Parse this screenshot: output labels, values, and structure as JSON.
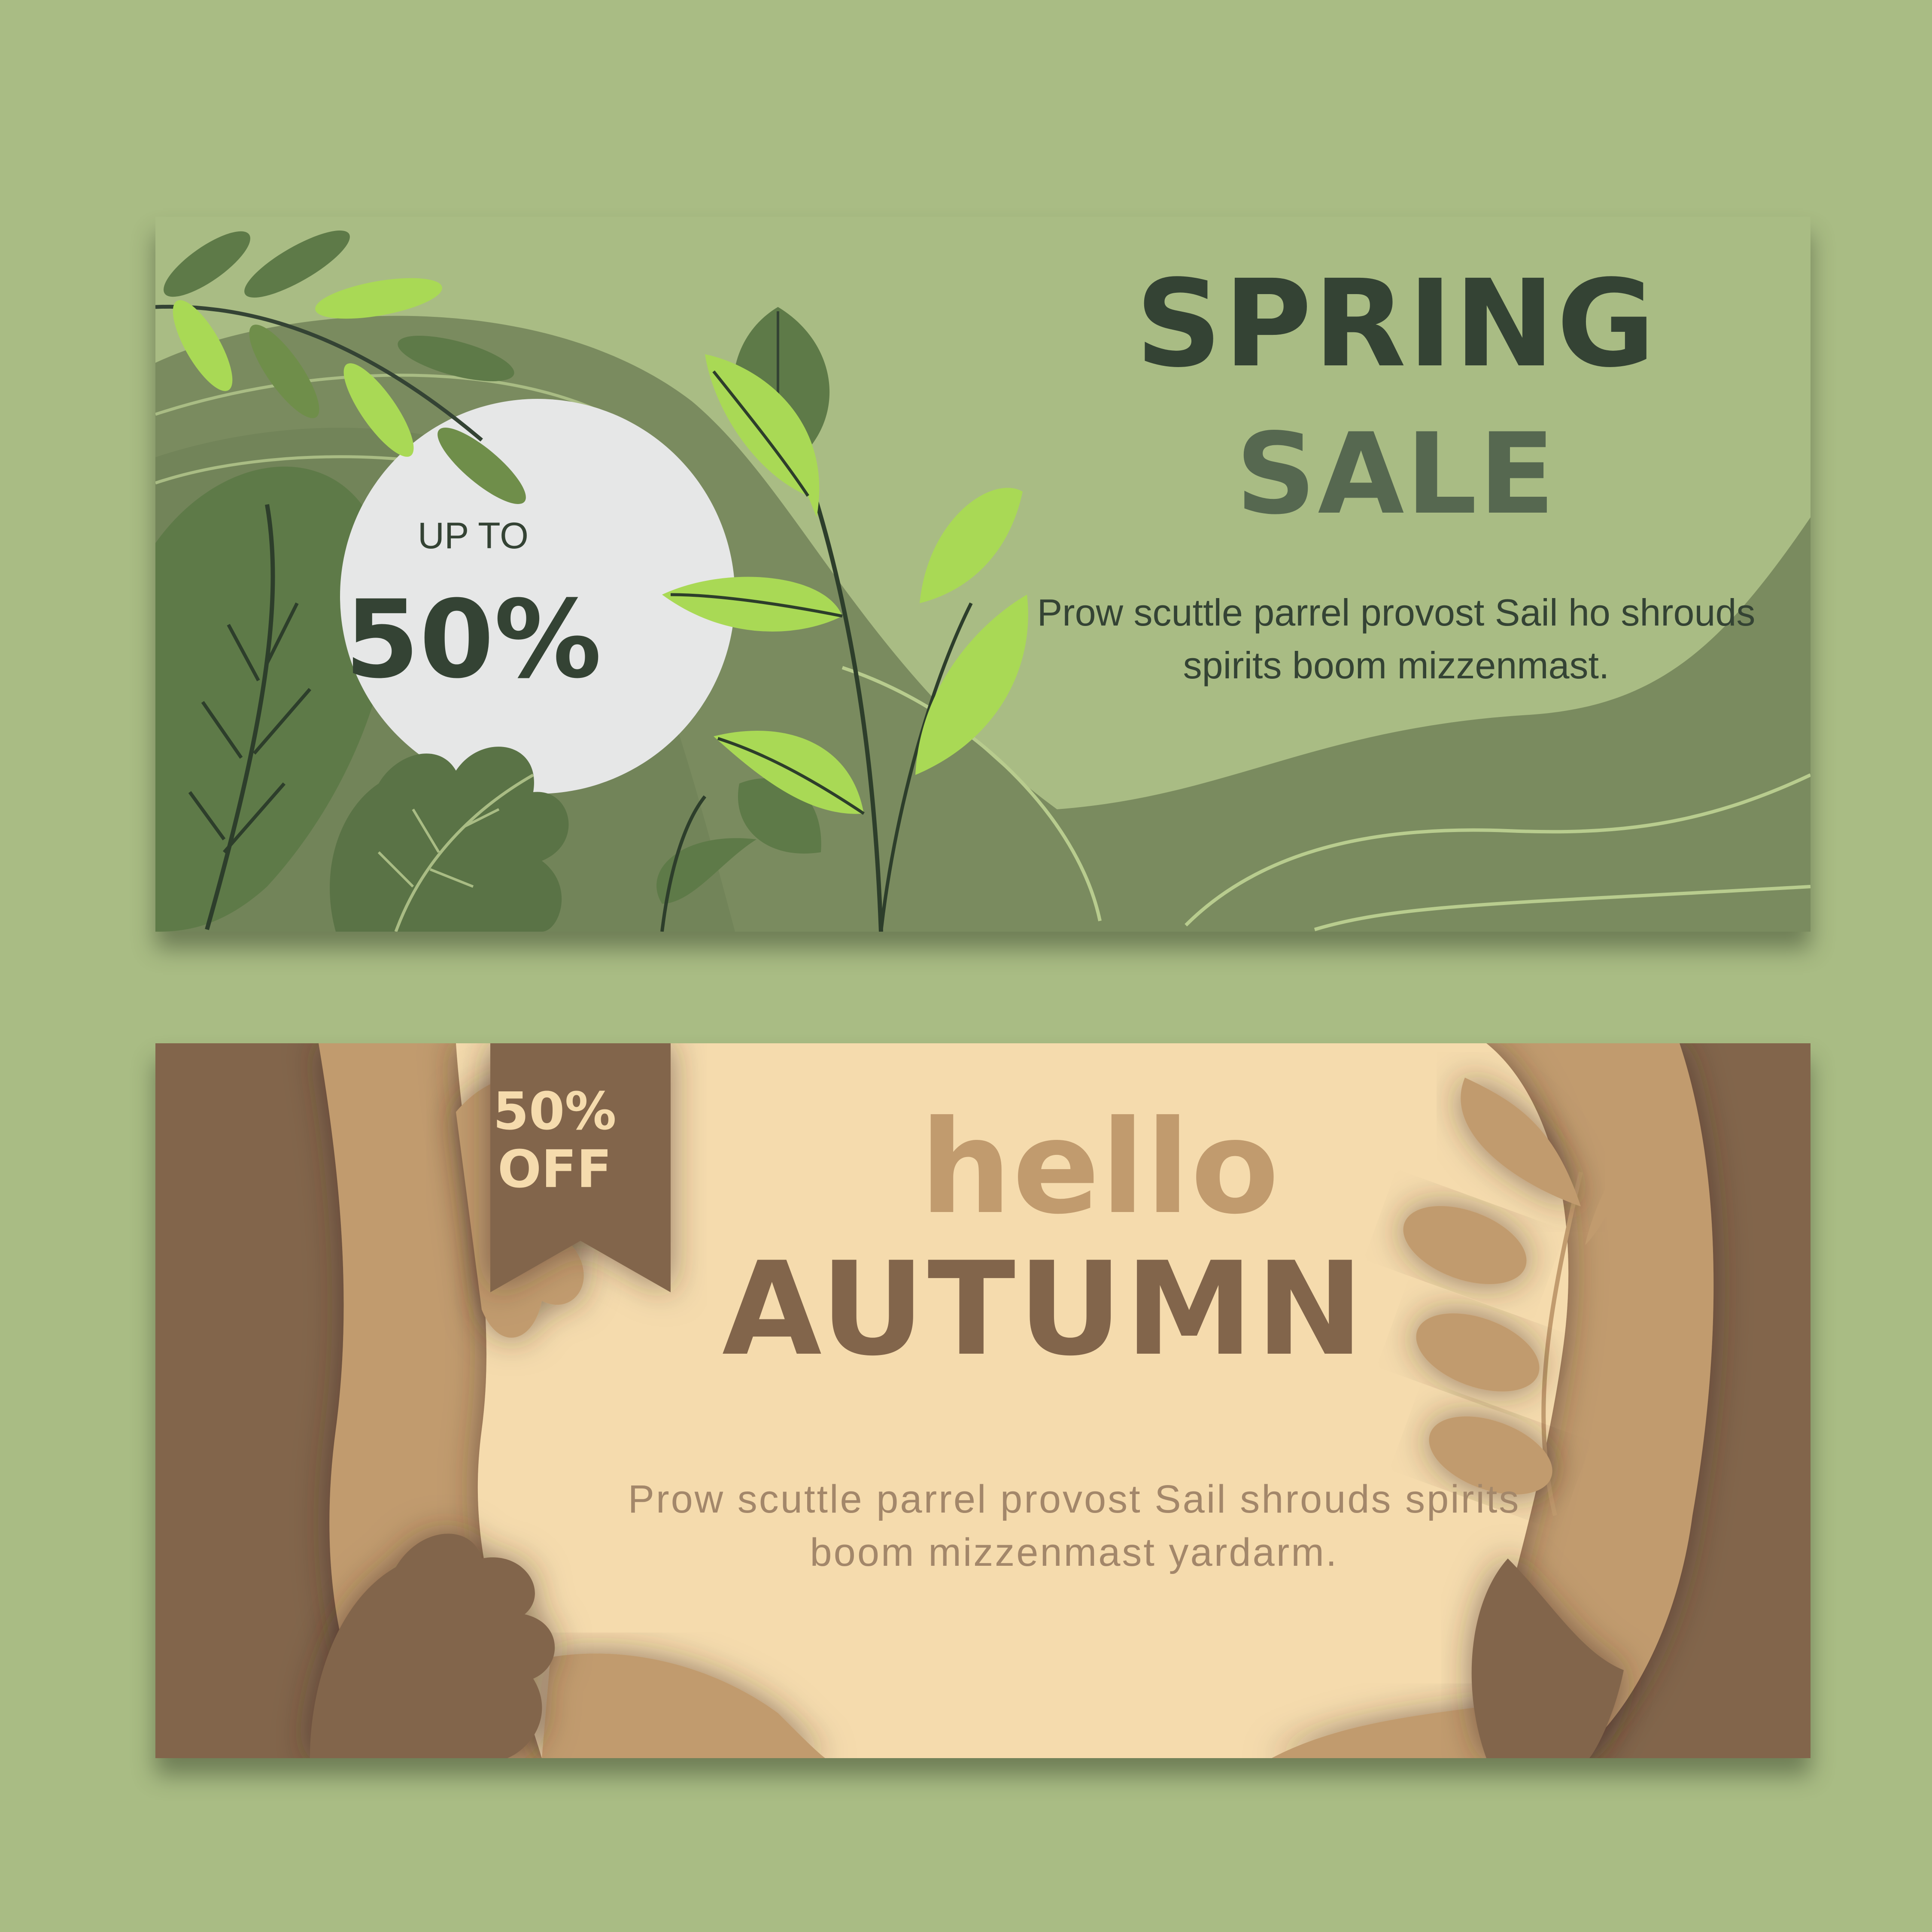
{
  "colors": {
    "page_background": "#a9bc84",
    "spring_dark": "#344334",
    "spring_mid": "#566850",
    "spring_light_green": "#a9d955",
    "circle": "#e6e7e7",
    "autumn_dark": "#82654b",
    "autumn_mid": "#c19b6e",
    "autumn_cream": "#f5dbad"
  },
  "spring_banner": {
    "title": "SPRING",
    "subtitle": "SALE",
    "copy": "Prow scuttle parrel provost Sail ho shrouds spirits boom mizzenmast.",
    "badge": {
      "upto": "UP TO",
      "percent": "50%"
    }
  },
  "autumn_banner": {
    "tag": {
      "percent": "50%",
      "off": "OFF"
    },
    "hello": "hello",
    "title": "AUTUMN",
    "copy": "Prow scuttle parrel provost Sail shrouds spirits boom mizzenmast yardarm."
  }
}
